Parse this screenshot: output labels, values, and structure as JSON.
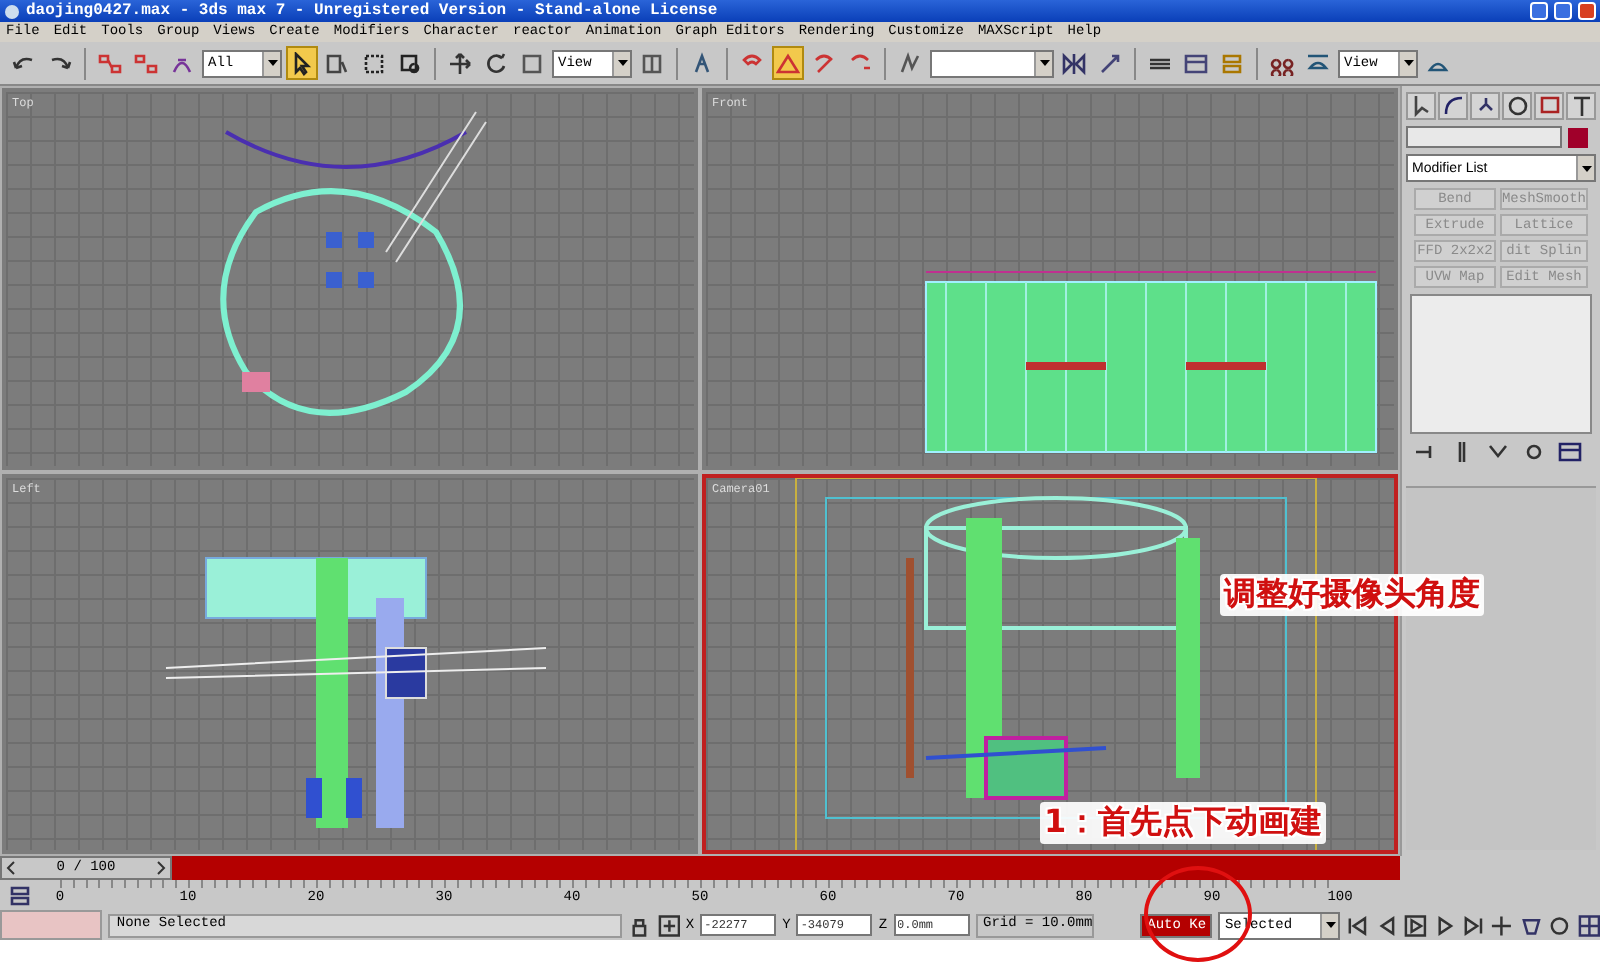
{
  "window": {
    "title": "daojing0427.max - 3ds max 7  - Unregistered Version - Stand-alone License"
  },
  "menu": [
    "File",
    "Edit",
    "Tools",
    "Group",
    "Views",
    "Create",
    "Modifiers",
    "Character",
    "reactor",
    "Animation",
    "Graph Editors",
    "Rendering",
    "Customize",
    "MAXScript",
    "Help"
  ],
  "toolbar": {
    "tools": [
      {
        "kind": "tool",
        "active": false
      },
      {
        "kind": "tool",
        "active": false
      },
      {
        "kind": "sep"
      },
      {
        "kind": "tool",
        "active": false
      },
      {
        "kind": "tool",
        "active": false
      },
      {
        "kind": "tool",
        "active": false
      },
      {
        "kind": "dropdown",
        "value": "All"
      },
      {
        "kind": "tool",
        "active": true
      },
      {
        "kind": "tool",
        "active": false
      },
      {
        "kind": "tool",
        "active": false
      },
      {
        "kind": "tool",
        "active": false
      },
      {
        "kind": "sep"
      },
      {
        "kind": "tool",
        "active": false
      },
      {
        "kind": "tool",
        "active": false
      },
      {
        "kind": "tool",
        "active": false
      },
      {
        "kind": "dropdown",
        "value": "View"
      },
      {
        "kind": "tool",
        "active": false
      },
      {
        "kind": "sep"
      },
      {
        "kind": "tool",
        "active": false
      },
      {
        "kind": "sep"
      },
      {
        "kind": "tool",
        "active": false
      },
      {
        "kind": "tool",
        "active": true
      },
      {
        "kind": "tool",
        "active": false
      },
      {
        "kind": "tool",
        "active": false
      },
      {
        "kind": "sep"
      },
      {
        "kind": "tool",
        "active": false
      },
      {
        "kind": "blank"
      },
      {
        "kind": "tool",
        "active": false
      },
      {
        "kind": "tool",
        "active": false
      },
      {
        "kind": "sep"
      },
      {
        "kind": "tool",
        "active": false
      },
      {
        "kind": "tool",
        "active": false
      },
      {
        "kind": "tool",
        "active": false
      },
      {
        "kind": "sep"
      },
      {
        "kind": "tool",
        "active": false
      },
      {
        "kind": "tool",
        "active": false
      },
      {
        "kind": "dropdown",
        "value": "View"
      },
      {
        "kind": "tool",
        "active": false
      }
    ]
  },
  "viewports": [
    {
      "label": "Top",
      "active": false
    },
    {
      "label": "Front",
      "active": false
    },
    {
      "label": "Left",
      "active": false
    },
    {
      "label": "Camera01",
      "active": true
    }
  ],
  "annotations": [
    "调整好摄像头角度",
    "1：首先点下动画建"
  ],
  "command_panel": {
    "modifier_list": "Modifier List",
    "modifiers": [
      {
        "label": "Bend",
        "disabled": true
      },
      {
        "label": "MeshSmooth",
        "disabled": true
      },
      {
        "label": "Extrude",
        "disabled": true
      },
      {
        "label": "Lattice",
        "disabled": true
      },
      {
        "label": "FFD 2x2x2",
        "disabled": true
      },
      {
        "label": "dit Splin",
        "disabled": true
      },
      {
        "label": "UVW Map",
        "disabled": true
      },
      {
        "label": "Edit Mesh",
        "disabled": true
      }
    ]
  },
  "timeline": {
    "frame": "0 / 100",
    "level": 0,
    "ticks": [
      "0",
      "10",
      "20",
      "30",
      "40",
      "50",
      "60",
      "70",
      "80",
      "90",
      "100"
    ]
  },
  "status": {
    "selection": "None Selected",
    "coords": [
      {
        "axis": "X",
        "value": "-22277"
      },
      {
        "axis": "Y",
        "value": "-34079"
      },
      {
        "axis": "Z",
        "value": "0.0mm"
      }
    ],
    "grid": "Grid = 10.0mm",
    "auto_key": {
      "label": "Auto Ke",
      "on": true
    },
    "key_filter": "Selected"
  }
}
